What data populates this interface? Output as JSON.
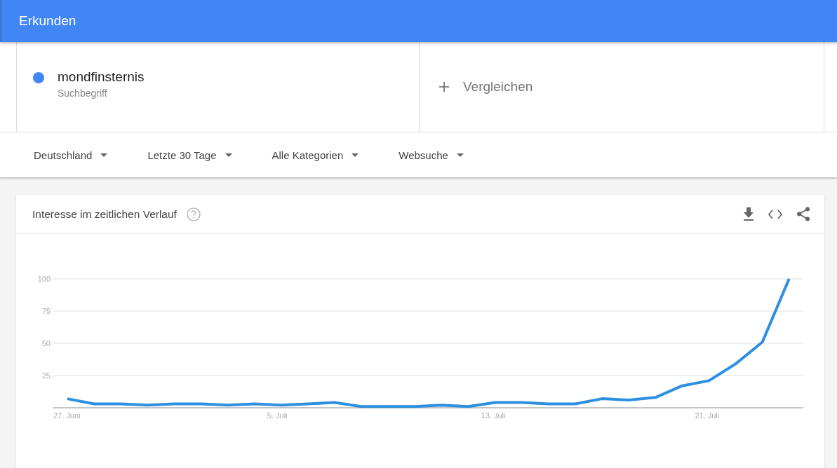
{
  "header": {
    "title": "Erkunden"
  },
  "terms": [
    {
      "name": "mondfinsternis",
      "subtitle": "Suchbegriff",
      "color": "#4285f4"
    }
  ],
  "compare": {
    "label": "Vergleichen"
  },
  "filters": [
    {
      "label": "Deutschland"
    },
    {
      "label": "Letzte 30 Tage"
    },
    {
      "label": "Alle Kategorien"
    },
    {
      "label": "Websuche"
    }
  ],
  "interest_card": {
    "title": "Interesse im zeitlichen Verlauf",
    "chart_data": {
      "type": "line",
      "categories": [
        "27. Juni",
        null,
        null,
        null,
        null,
        null,
        null,
        null,
        "5. Juli",
        null,
        null,
        null,
        null,
        null,
        null,
        null,
        "13. Juli",
        null,
        null,
        null,
        null,
        null,
        null,
        null,
        "21. Juli",
        null,
        null,
        null
      ],
      "series": [
        {
          "color": "#2d8fe0",
          "values": [
            7,
            3,
            3,
            2,
            3,
            3,
            2,
            3,
            2,
            3,
            4,
            1,
            1,
            1,
            2,
            1,
            4,
            4,
            3,
            3,
            7,
            6,
            8,
            17,
            21,
            34,
            51,
            100
          ]
        }
      ],
      "grid": true,
      "ylim": [
        0,
        100
      ],
      "yticks": [
        25,
        50,
        75,
        100
      ]
    }
  }
}
